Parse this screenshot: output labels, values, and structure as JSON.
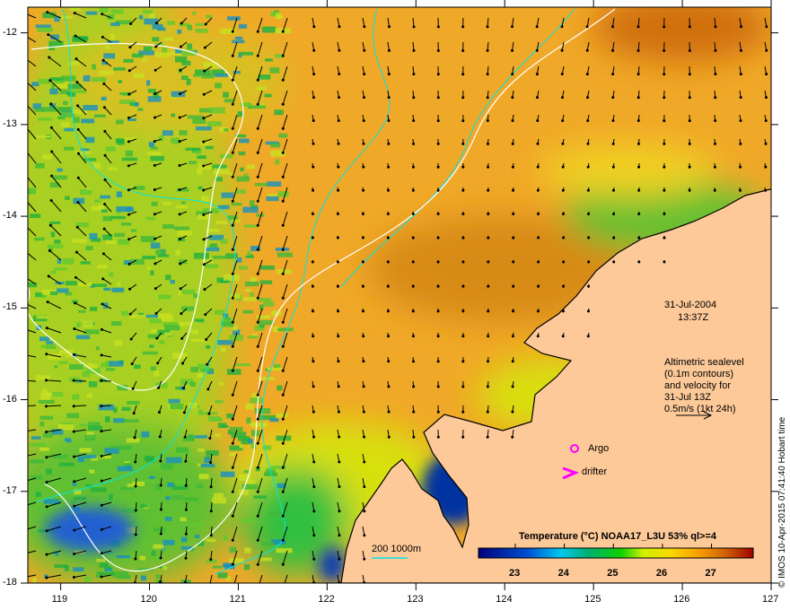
{
  "map": {
    "lon_ticks": [
      "119",
      "120",
      "121",
      "122",
      "123",
      "124",
      "125",
      "126",
      "127"
    ],
    "lat_ticks": [
      "-12",
      "-13",
      "-14",
      "-15",
      "-16",
      "-17",
      "-18"
    ],
    "lon_range": [
      118.63,
      127.0
    ],
    "lat_range": [
      -11.72,
      -18.0
    ]
  },
  "annotation": {
    "date": "31-Jul-2004",
    "time": "13:37Z",
    "desc_lines": [
      "Altimetric sealevel",
      "(0.1m contours)",
      "and velocity for",
      "31-Jul 13Z",
      "0.5m/s (1kt 24h)"
    ]
  },
  "markers": {
    "argo": "Argo",
    "drifter": "drifter"
  },
  "scale": {
    "label": "200  1000m"
  },
  "legend": {
    "title": "Temperature (°C) NOAA17_L3U 53% ql>=4",
    "ticks": [
      "23",
      "24",
      "25",
      "26",
      "27"
    ],
    "range": [
      22.25,
      27.85
    ]
  },
  "credit": "© IMOS 10-Apr-2015 07:41:40 Hobart time",
  "colors": {
    "land": "#fdc999",
    "marker": "#ff00ff",
    "contour_shelf": "#00e5e5",
    "sealevel_contour": "#ffffff"
  }
}
